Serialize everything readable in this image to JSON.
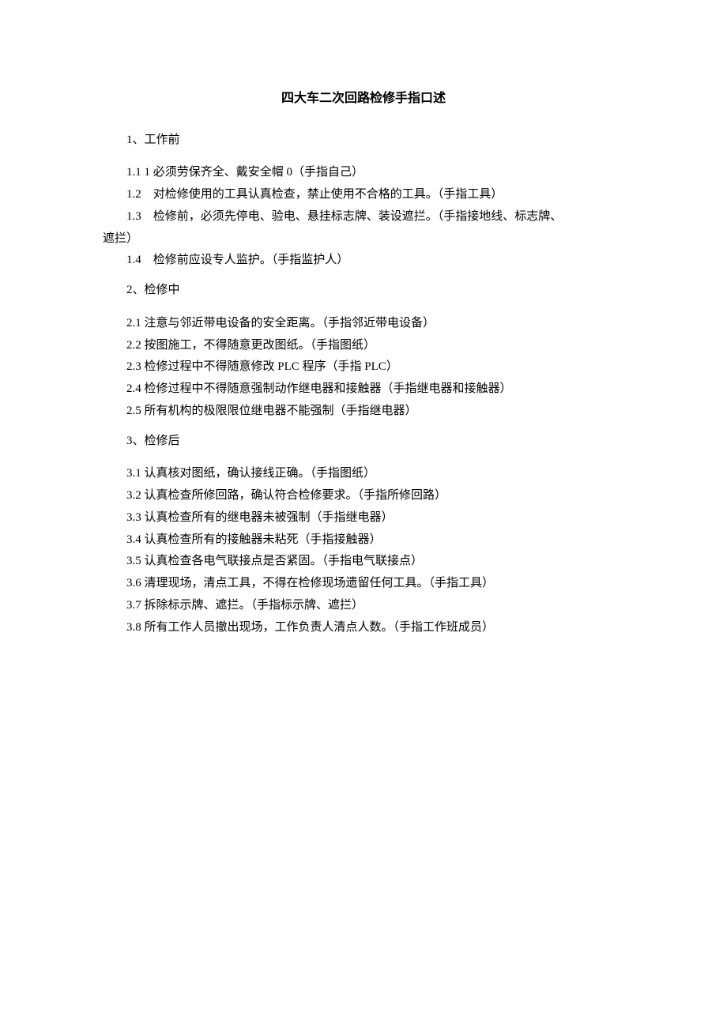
{
  "title": "四大车二次回路检修手指口述",
  "sections": [
    {
      "heading": "1、工作前",
      "items": [
        "1.1 1 必须劳保齐全、戴安全帽 0（手指自己）",
        "1.2　对检修使用的工具认真检查，禁止使用不合格的工具。（手指工具）",
        "1.3　检修前，必须先停电、验电、悬挂标志牌、装设遮拦。（手指接地线、标志牌、",
        "遮拦）",
        "1.4　检修前应设专人监护。（手指监护人）"
      ]
    },
    {
      "heading": "2、检修中",
      "items": [
        "2.1 注意与邻近带电设备的安全距离。（手指邻近带电设备）",
        "2.2 按图施工，不得随意更改图纸。（手指图纸）",
        "2.3 检修过程中不得随意修改 PLC 程序（手指 PLC）",
        "2.4 检修过程中不得随意强制动作继电器和接触器（手指继电器和接触器）",
        "2.5 所有机构的极限限位继电器不能强制（手指继电器）"
      ]
    },
    {
      "heading": "3、检修后",
      "items": [
        "3.1 认真核对图纸，确认接线正确。（手指图纸）",
        "3.2 认真检查所修回路，确认符合检修要求。（手指所修回路）",
        "3.3 认真检查所有的继电器未被强制（手指继电器）",
        "3.4 认真检查所有的接触器未粘死（手指接触器）",
        "3.5 认真检查各电气联接点是否紧固。（手指电气联接点）",
        "3.6 清理现场，清点工具，不得在检修现场遗留任何工具。（手指工具）",
        "3.7 拆除标示牌、遮拦。（手指标示牌、遮拦）",
        "3.8 所有工作人员撤出现场，工作负责人清点人数。（手指工作班成员）"
      ]
    }
  ]
}
